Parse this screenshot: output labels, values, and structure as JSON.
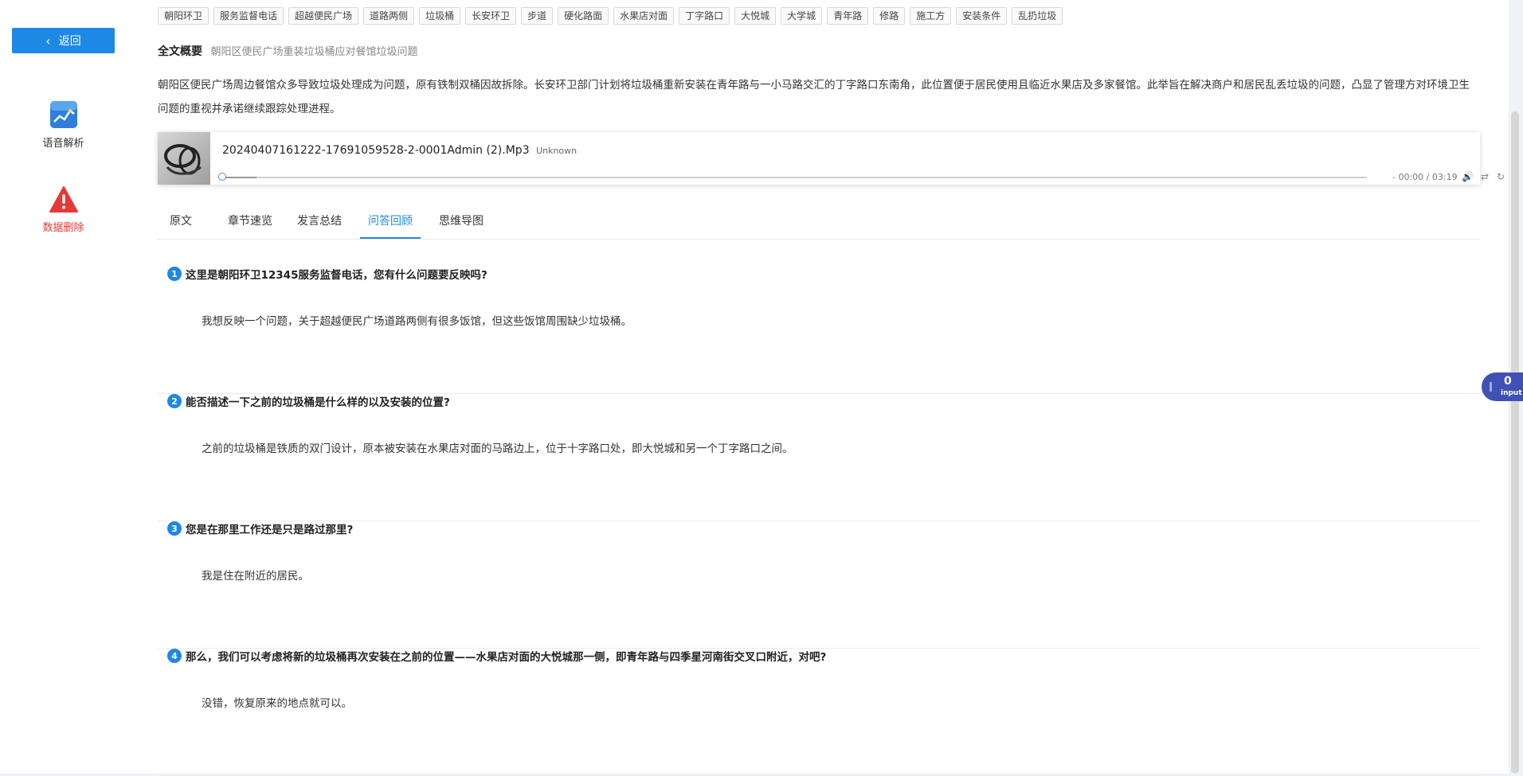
{
  "sidebar": {
    "back_label": "返回",
    "items": [
      {
        "label": "语音解析",
        "icon": "chart-icon"
      },
      {
        "label": "数据删除",
        "icon": "warning-icon",
        "color": "#e53935"
      }
    ]
  },
  "tags": [
    "朝阳环卫",
    "服务监督电话",
    "超越便民广场",
    "道路两侧",
    "垃圾桶",
    "长安环卫",
    "步道",
    "硬化路面",
    "水果店对面",
    "丁字路口",
    "大悦城",
    "大学城",
    "青年路",
    "修路",
    "施工方",
    "安装条件",
    "乱扔垃圾"
  ],
  "summary": {
    "label": "全文概要",
    "title": "朝阳区便民广场重装垃圾桶应对餐馆垃圾问题",
    "body": "朝阳区便民广场周边餐馆众多导致垃圾处理成为问题，原有铁制双桶因故拆除。长安环卫部门计划将垃圾桶重新安装在青年路与一小马路交汇的丁字路口东南角，此位置便于居民使用且临近水果店及多家餐馆。此举旨在解决商户和居民乱丢垃圾的问题，凸显了管理方对环境卫生问题的重视并承诺继续跟踪处理进程。"
  },
  "player": {
    "file": "20240407161222-17691059528-2-0001Admin (2).Mp3",
    "artist": "Unknown",
    "time": "- 00:00 / 03:19",
    "progress": 0.03
  },
  "tabs": [
    {
      "label": "原文",
      "active": false
    },
    {
      "label": "章节速览",
      "active": false
    },
    {
      "label": "发言总结",
      "active": false
    },
    {
      "label": "问答回顾",
      "active": true
    },
    {
      "label": "思维导图",
      "active": false
    }
  ],
  "qa": [
    {
      "num": "1",
      "q": "这里是朝阳环卫12345服务监督电话，您有什么问题要反映吗?",
      "a": "我想反映一个问题，关于超越便民广场道路两侧有很多饭馆，但这些饭馆周围缺少垃圾桶。"
    },
    {
      "num": "2",
      "q": "能否描述一下之前的垃圾桶是什么样的以及安装的位置?",
      "a": "之前的垃圾桶是铁质的双门设计，原本被安装在水果店对面的马路边上，位于十字路口处，即大悦城和另一个丁字路口之间。"
    },
    {
      "num": "3",
      "q": "您是在那里工作还是只是路过那里?",
      "a": "我是住在附近的居民。"
    },
    {
      "num": "4",
      "q": "那么，我们可以考虑将新的垃圾桶再次安装在之前的位置——水果店对面的大悦城那一侧，即青年路与四季星河南街交叉口附近，对吧?",
      "a": "没错，恢复原来的地点就可以。"
    }
  ],
  "badge": {
    "count": "0",
    "label": "input"
  },
  "colors": {
    "accent": "#1e88e5",
    "danger": "#e53935",
    "badge": "#3f51b5"
  }
}
